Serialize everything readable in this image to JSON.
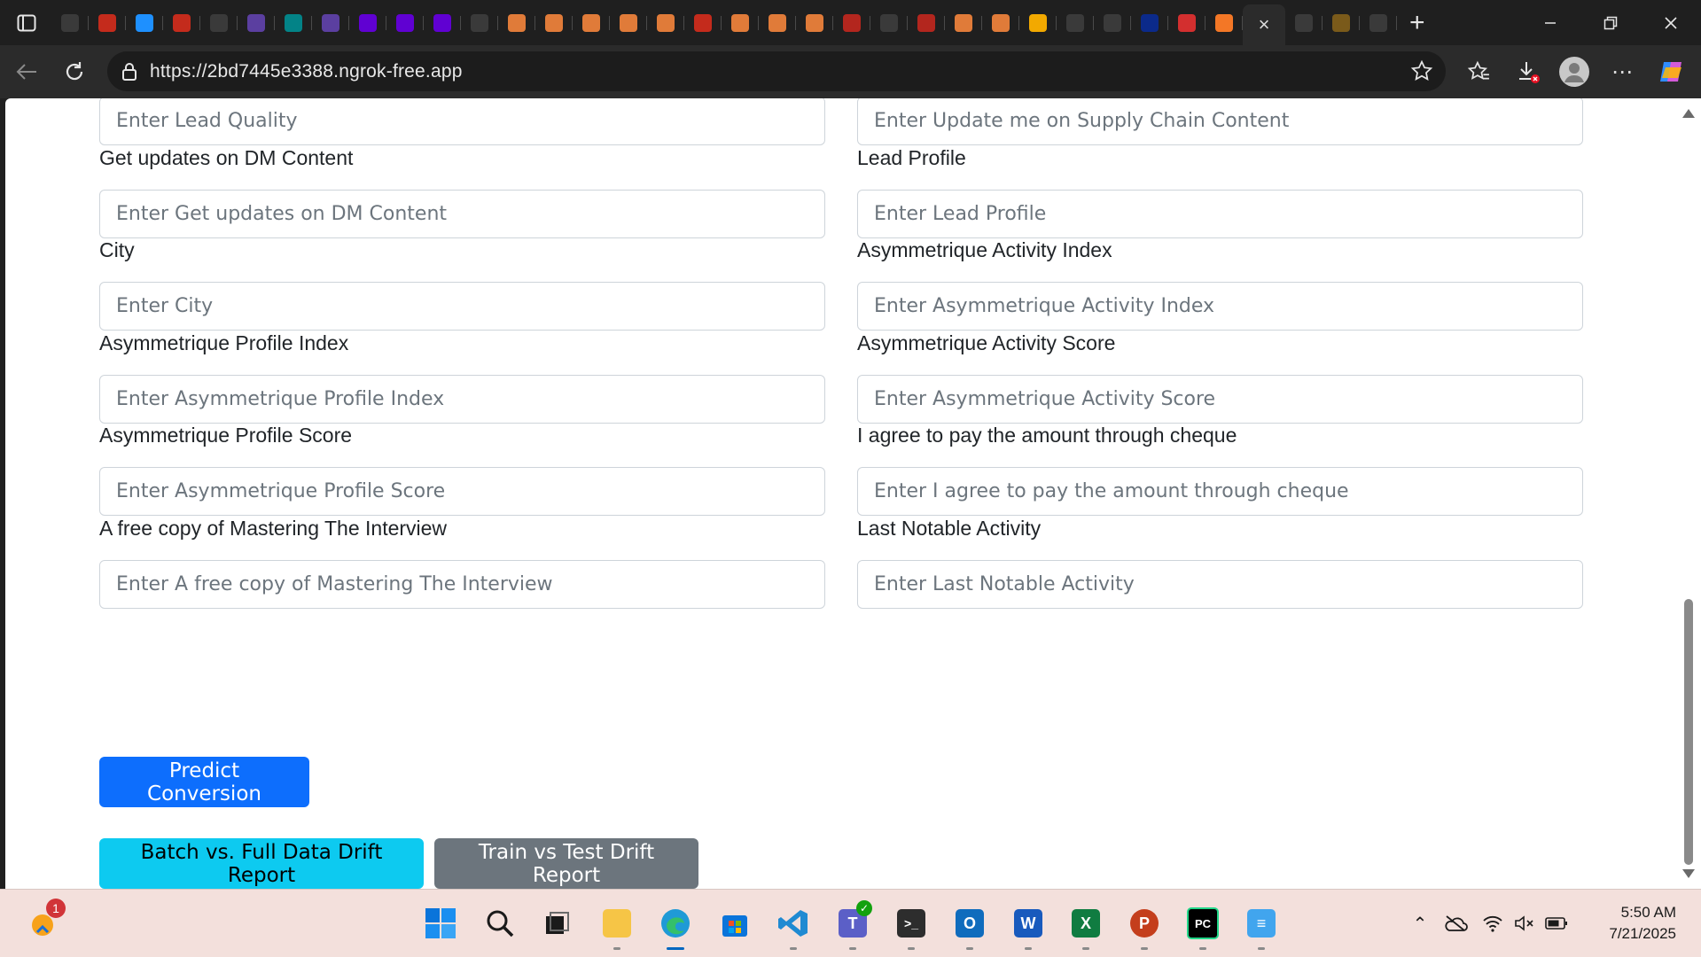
{
  "browser": {
    "url": "https://2bd7445e3388.ngrok-free.app",
    "tabs": [
      {
        "icon": "settings-gear-icon",
        "color": "#3a3a3a"
      },
      {
        "icon": "bar-chart-icon",
        "color": "#c42b1c"
      },
      {
        "icon": "sync-icon",
        "color": "#1e90ff"
      },
      {
        "icon": "bar-chart-icon",
        "color": "#c42b1c"
      },
      {
        "icon": "openai-icon",
        "color": "#3a3a3a"
      },
      {
        "icon": "video-icon",
        "color": "#5b3fa0"
      },
      {
        "icon": "sharepoint-icon",
        "color": "#038387"
      },
      {
        "icon": "video-icon",
        "color": "#5b3fa0"
      },
      {
        "icon": "yahoo-icon",
        "color": "#6001d2"
      },
      {
        "icon": "yahoo-icon",
        "color": "#6001d2"
      },
      {
        "icon": "yahoo-icon",
        "color": "#6001d2"
      },
      {
        "icon": "document-icon",
        "color": "#3a3a3a"
      },
      {
        "icon": "box-icon",
        "color": "#e07b39"
      },
      {
        "icon": "box-icon",
        "color": "#e07b39"
      },
      {
        "icon": "box-icon",
        "color": "#e07b39"
      },
      {
        "icon": "box-icon",
        "color": "#e07b39"
      },
      {
        "icon": "box-icon",
        "color": "#e07b39"
      },
      {
        "icon": "news-icon",
        "color": "#c42b1c"
      },
      {
        "icon": "box-icon",
        "color": "#e07b39"
      },
      {
        "icon": "box-icon",
        "color": "#e07b39"
      },
      {
        "icon": "box-icon",
        "color": "#e07b39"
      },
      {
        "icon": "pdf-icon",
        "color": "#b3261e"
      },
      {
        "icon": "settings-gear-icon",
        "color": "#3a3a3a"
      },
      {
        "icon": "pdf-icon",
        "color": "#b3261e"
      },
      {
        "icon": "box-icon",
        "color": "#e07b39"
      },
      {
        "icon": "box-icon",
        "color": "#e07b39"
      },
      {
        "icon": "brain-icon",
        "color": "#f2a900"
      },
      {
        "icon": "settings-gear-icon",
        "color": "#3a3a3a"
      },
      {
        "icon": "openai-icon",
        "color": "#3a3a3a"
      },
      {
        "icon": "notion-n-icon",
        "color": "#0b2a8a"
      },
      {
        "icon": "pdf-icon",
        "color": "#d32f2f"
      },
      {
        "icon": "jupyter-icon",
        "color": "#f37726"
      }
    ],
    "active_tab_close": "×",
    "extra_tabs": [
      {
        "icon": "document-icon",
        "color": "#3a3a3a"
      },
      {
        "icon": "brain-icon",
        "color": "#7a5a1a"
      },
      {
        "icon": "globe-icon",
        "color": "#3a3a3a"
      }
    ]
  },
  "form": {
    "fields": [
      {
        "label": "",
        "placeholder": "Enter Lead Quality",
        "col": "left"
      },
      {
        "label": "",
        "placeholder": "Enter Update me on Supply Chain Content",
        "col": "right"
      },
      {
        "label": "Get updates on DM Content",
        "placeholder": "Enter Get updates on DM Content",
        "col": "left"
      },
      {
        "label": "Lead Profile",
        "placeholder": "Enter Lead Profile",
        "col": "right"
      },
      {
        "label": "City",
        "placeholder": "Enter City",
        "col": "left"
      },
      {
        "label": "Asymmetrique Activity Index",
        "placeholder": "Enter Asymmetrique Activity Index",
        "col": "right"
      },
      {
        "label": "Asymmetrique Profile Index",
        "placeholder": "Enter Asymmetrique Profile Index",
        "col": "left"
      },
      {
        "label": "Asymmetrique Activity Score",
        "placeholder": "Enter Asymmetrique Activity Score",
        "col": "right"
      },
      {
        "label": "Asymmetrique Profile Score",
        "placeholder": "Enter Asymmetrique Profile Score",
        "col": "left"
      },
      {
        "label": "I agree to pay the amount through cheque",
        "placeholder": "Enter I agree to pay the amount through cheque",
        "col": "right"
      },
      {
        "label": "A free copy of Mastering The Interview",
        "placeholder": "Enter A free copy of Mastering The Interview",
        "col": "left"
      },
      {
        "label": "Last Notable Activity",
        "placeholder": "Enter Last Notable Activity",
        "col": "right"
      }
    ],
    "predict_button": "Predict Conversion",
    "batch_report_button": "Batch vs. Full Data Drift Report",
    "train_test_report_button": "Train vs Test Drift Report"
  },
  "taskbar": {
    "notification_badge": "1",
    "clock_time": "5:50 AM",
    "clock_date": "7/21/2025"
  }
}
